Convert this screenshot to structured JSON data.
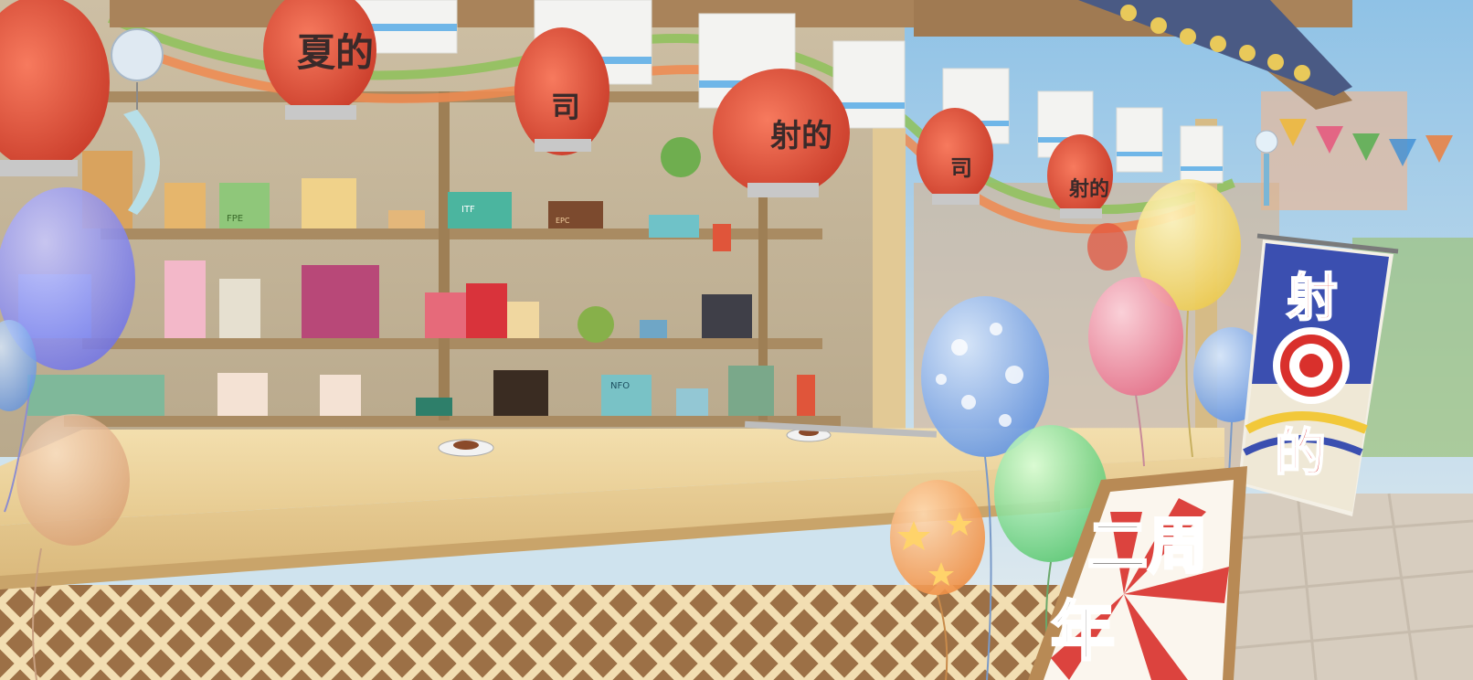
{
  "scene": {
    "type": "festival-shooting-gallery-stall-background"
  },
  "lanterns": [
    {
      "text": ""
    },
    {
      "text": "夏的"
    },
    {
      "text": "司"
    },
    {
      "text": "射的"
    },
    {
      "text": "司"
    },
    {
      "text": "射的"
    }
  ],
  "banner": {
    "top_text": "射",
    "bottom_text": "的"
  },
  "anniversary_sign": {
    "line1": "二周",
    "line2": "年"
  },
  "shelf_box_labels": [
    "FPE",
    "ITF",
    "NFO",
    "EPC"
  ],
  "colors": {
    "lantern_red": "#e2513b",
    "wood": "#e9cf98",
    "banner_blue": "#3b4fb0",
    "sign_red": "#d9302c"
  }
}
